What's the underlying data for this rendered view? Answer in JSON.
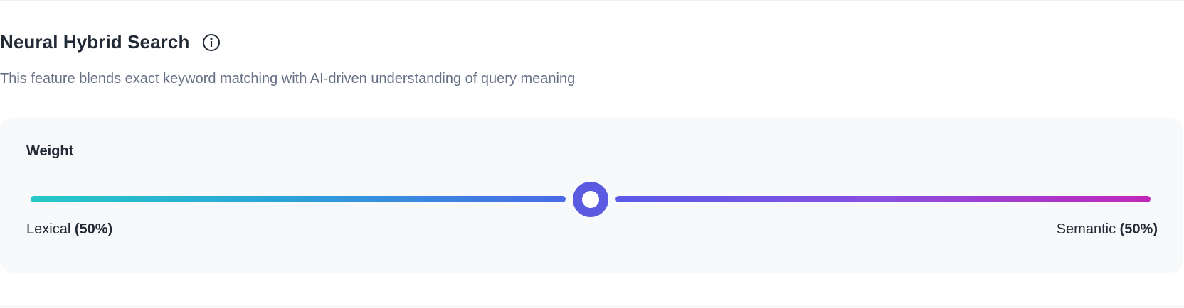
{
  "section": {
    "title": "Neural Hybrid Search",
    "info_icon": "info-circle-icon",
    "description": "This feature blends exact keyword matching with AI-driven understanding of query meaning"
  },
  "weight": {
    "label": "Weight",
    "value": 0.5,
    "lexical_label": "Lexical",
    "lexical_value": "(50%)",
    "semantic_label": "Semantic",
    "semantic_value": "(50%)"
  },
  "colors": {
    "thumb": "#5a5be0",
    "track_start": "#26c9c6",
    "track_end": "#c028bb",
    "panel_bg": "#f8f9fa"
  }
}
